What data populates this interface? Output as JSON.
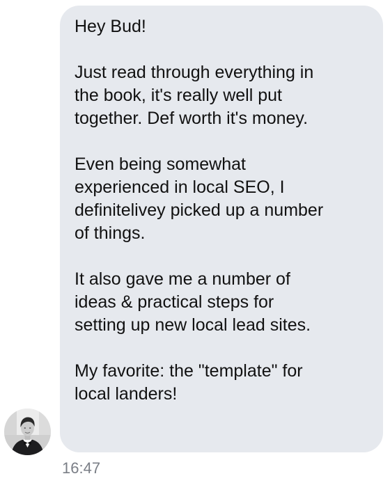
{
  "message": {
    "paragraphs": [
      "Hey Bud!",
      "Just read through everything in\nthe book, it's really well put\ntogether. Def worth it's money.",
      "Even being somewhat\nexperienced in local SEO, I\ndefinitelivey picked up a number\nof things.",
      "It also gave me a number of\nideas & practical steps for\nsetting up new local lead sites.",
      "My favorite: the \"template\" for\nlocal landers!"
    ],
    "timestamp": "16:47"
  },
  "colors": {
    "bubble": "#e6e9ee",
    "text": "#111111",
    "timestamp": "#7a7e86"
  },
  "avatar": {
    "icon": "user-avatar-photo"
  }
}
